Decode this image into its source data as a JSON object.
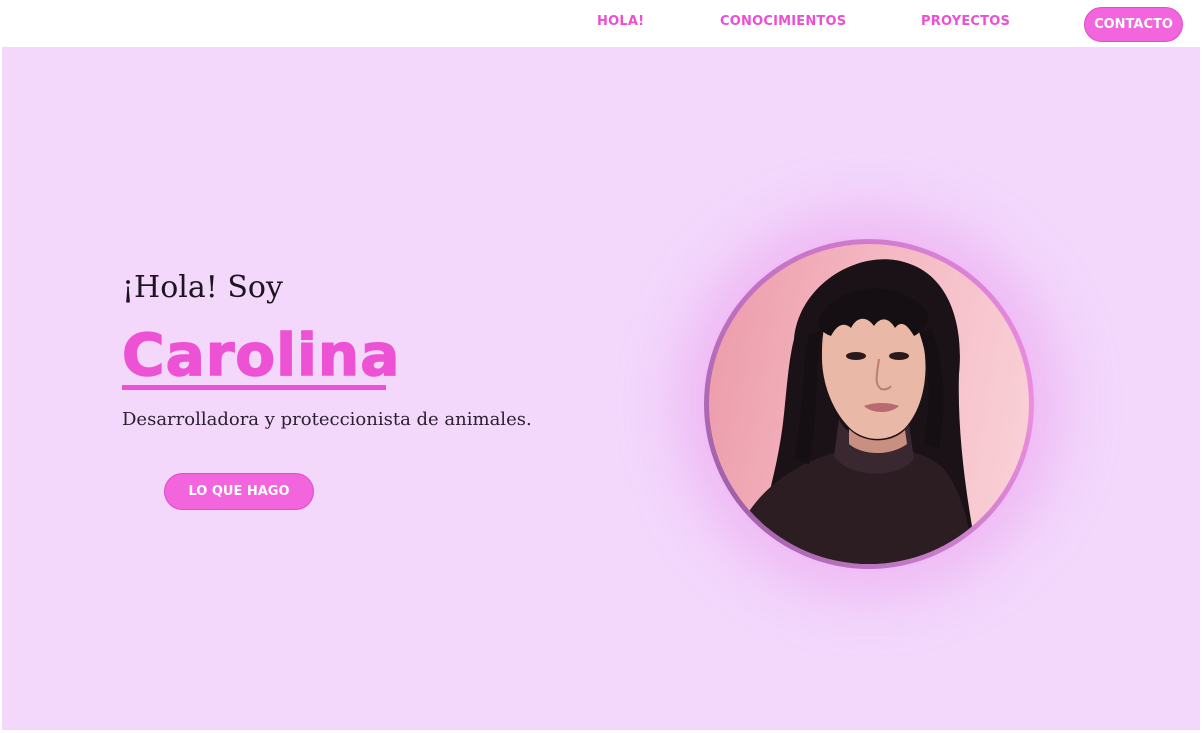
{
  "nav": {
    "items": [
      {
        "label": "HOLA!"
      },
      {
        "label": "CONOCIMIENTOS"
      },
      {
        "label": "PROYECTOS"
      }
    ],
    "contact_label": "CONTACTO"
  },
  "hero": {
    "greeting": "¡Hola! Soy",
    "name": "Carolina",
    "tagline": "Desarrolladora y proteccionista de animales.",
    "cta_label": "LO QUE HAGO"
  },
  "colors": {
    "accent": "#f265dd",
    "hero_background": "#f3d8fc",
    "text_dark": "#1e1420"
  }
}
